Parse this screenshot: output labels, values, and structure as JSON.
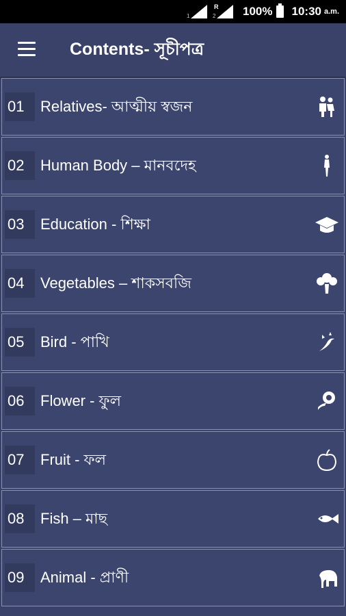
{
  "status_bar": {
    "sim1_label": "1",
    "sim2_roaming": "R",
    "sim2_label": "2",
    "battery": "100%",
    "time": "10:30",
    "ampm": "a.m."
  },
  "app_bar": {
    "title": "Contents- সূচীপত্র",
    "menu_icon": "hamburger-menu-icon"
  },
  "items": [
    {
      "num": "01",
      "label": "Relatives- আত্মীয় স্বজন",
      "icon": "family-icon"
    },
    {
      "num": "02",
      "label": "Human Body – মানবদেহ",
      "icon": "human-body-icon"
    },
    {
      "num": "03",
      "label": "Education - শিক্ষা",
      "icon": "graduation-cap-icon"
    },
    {
      "num": "04",
      "label": "Vegetables – শাকসবজি",
      "icon": "vegetables-icon"
    },
    {
      "num": "05",
      "label": "Bird - পাখি",
      "icon": "bird-icon"
    },
    {
      "num": "06",
      "label": "Flower - ফুল",
      "icon": "flower-icon"
    },
    {
      "num": "07",
      "label": "Fruit - ফল",
      "icon": "apple-icon"
    },
    {
      "num": "08",
      "label": "Fish – মাছ",
      "icon": "fish-icon"
    },
    {
      "num": "09",
      "label": "Animal - প্রাণী",
      "icon": "elephant-icon"
    }
  ],
  "colors": {
    "background": "#3a4269",
    "item_border": "#8a93b4",
    "number_box": "#323a5e",
    "text": "#ffffff"
  }
}
